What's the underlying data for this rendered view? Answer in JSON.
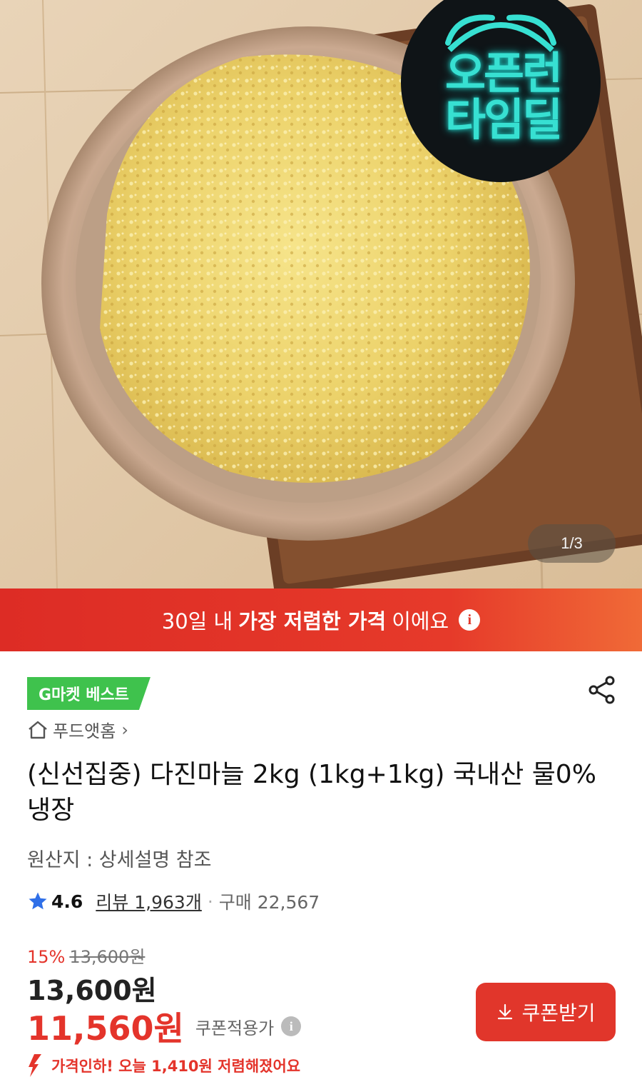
{
  "hero": {
    "image_alt": "다진마늘",
    "badge_lines": [
      "오픈런",
      "타임딜"
    ],
    "counter": "1/3"
  },
  "banner": {
    "prefix": "30일 내 ",
    "emph": "가장 저렴한 가격",
    "suffix": "이에요",
    "info_icon": "info-icon"
  },
  "product": {
    "best_badge": "G마켓 베스트",
    "store": "푸드앳홈",
    "title": "(신선집중) 다진마늘 2kg (1kg+1kg) 국내산 물0% 냉장",
    "origin": "원산지 : 상세설명 참조",
    "rating": "4.6",
    "reviews": "리뷰 1,963개",
    "purchases": "구매 22,567",
    "discount_rate": "15%",
    "original_price": "13,600원",
    "price": "13,600원",
    "coupon_price": "11,560원",
    "coupon_label": "쿠폰적용가",
    "price_drop": "가격인하! 오늘 1,410원 저렴해졌어요",
    "coupon_button": "쿠폰받기"
  },
  "colors": {
    "accent": "#e4342b",
    "best": "#3fc24d",
    "badge_glow": "#37e0d2"
  }
}
